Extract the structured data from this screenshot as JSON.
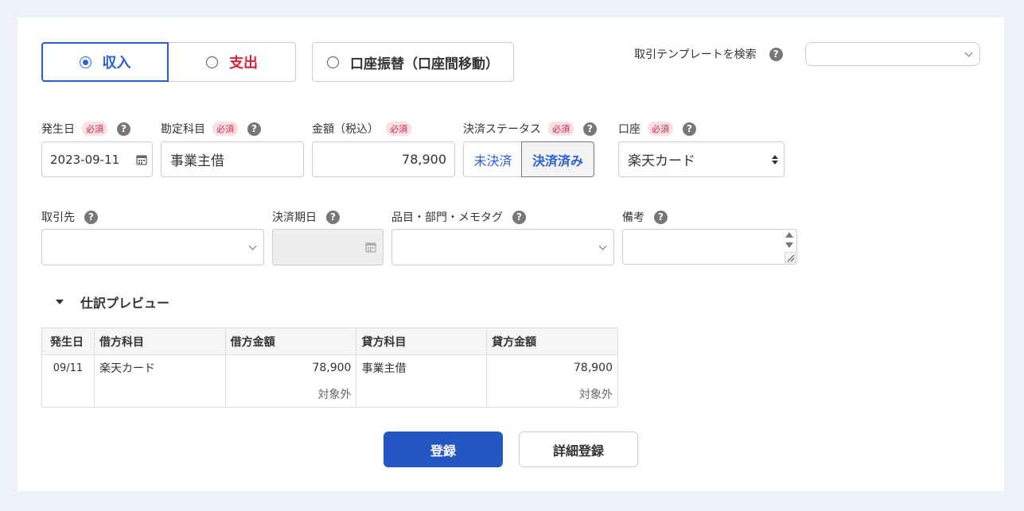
{
  "type_tabs": {
    "income": "収入",
    "expense": "支出",
    "transfer": "口座振替（口座間移動）"
  },
  "template_search": {
    "label": "取引テンプレートを検索",
    "value": ""
  },
  "required_badge": "必須",
  "help_glyph": "?",
  "row1": {
    "date_label": "発生日",
    "date_value": "2023-09-11",
    "account_item_label": "勘定科目",
    "account_item_value": "事業主借",
    "amount_label": "金額（税込）",
    "amount_value": "78,900",
    "status_label": "決済ステータス",
    "status_unsettled": "未決済",
    "status_settled": "決済済み",
    "wallet_label": "口座",
    "wallet_value": "楽天カード"
  },
  "row2": {
    "partner_label": "取引先",
    "partner_value": "",
    "due_label": "決済期日",
    "due_value": "",
    "tags_label": "品目・部門・メモタグ",
    "tags_value": "",
    "memo_label": "備考",
    "memo_value": ""
  },
  "preview": {
    "title": "仕訳プレビュー",
    "headers": [
      "発生日",
      "借方科目",
      "借方金額",
      "貸方科目",
      "貸方金額"
    ],
    "row": {
      "date": "09/11",
      "debit_account": "楽天カード",
      "debit_amount": "78,900",
      "debit_tax": "対象外",
      "credit_account": "事業主借",
      "credit_amount": "78,900",
      "credit_tax": "対象外"
    }
  },
  "actions": {
    "register": "登録",
    "detailed_register": "詳細登録"
  },
  "colors": {
    "accent": "#2b60d3",
    "expense": "#d7213a",
    "primary_button": "#2557c4",
    "page_bg": "#eef1f9"
  },
  "icons": [
    "radio-icon",
    "help-icon",
    "calendar-icon",
    "chevron-down-icon",
    "sort-arrows-icon",
    "spin-arrows-icon",
    "resize-grip-icon",
    "caret-down-icon"
  ]
}
